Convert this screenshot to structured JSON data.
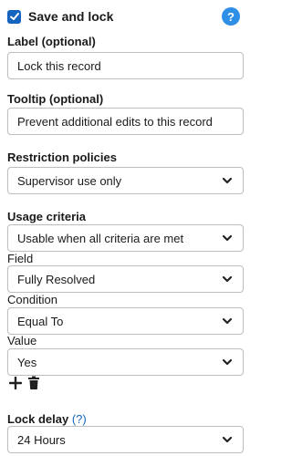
{
  "header": {
    "title": "Save and lock",
    "checked": true,
    "help": "?"
  },
  "label_section": {
    "label": "Label (optional)",
    "value": "Lock this record"
  },
  "tooltip_section": {
    "label": "Tooltip (optional)",
    "value": "Prevent additional edits to this record"
  },
  "restriction": {
    "label": "Restriction policies",
    "selected": "Supervisor use only"
  },
  "usage": {
    "label": "Usage criteria",
    "selected": "Usable when all criteria are met"
  },
  "criteria": {
    "field": {
      "label": "Field",
      "selected": "Fully Resolved"
    },
    "condition": {
      "label": "Condition",
      "selected": "Equal To"
    },
    "value": {
      "label": "Value",
      "selected": "Yes"
    }
  },
  "tools": {
    "add_icon": "plus-icon",
    "delete_icon": "trash-icon"
  },
  "lock_delay": {
    "label": "Lock delay",
    "help": "(?)",
    "selected": "24 Hours"
  },
  "colors": {
    "accent": "#1565c0",
    "help_badge": "#2f8fe6",
    "border": "#bdbdbd"
  }
}
